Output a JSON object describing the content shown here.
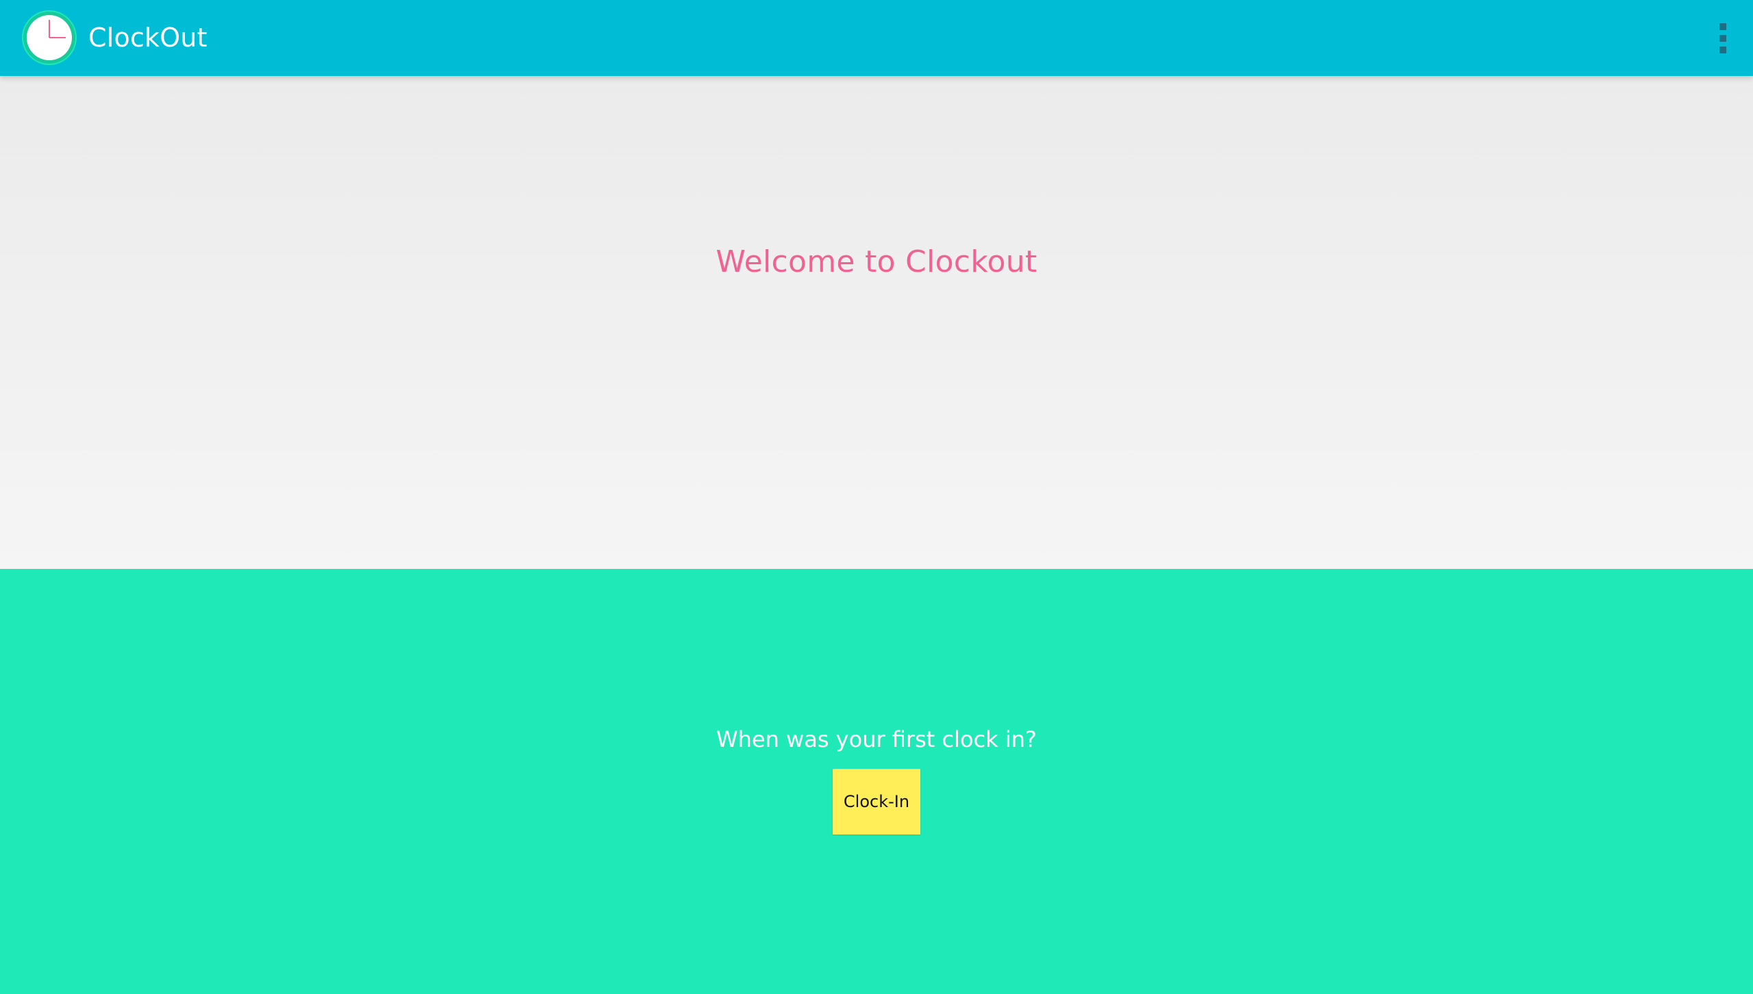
{
  "appbar": {
    "title": "ClockOut",
    "logo_icon": "clock-icon",
    "menu_icon": "more-vertical-icon",
    "background_color": "#00bcd4"
  },
  "welcome": {
    "heading": "Welcome to Clockout",
    "text_color": "#f06292"
  },
  "clock_panel": {
    "question": "When was your first clock in?",
    "button_label": "Clock-In",
    "background_color": "#1fe9b6",
    "button_color": "#ffee58"
  }
}
